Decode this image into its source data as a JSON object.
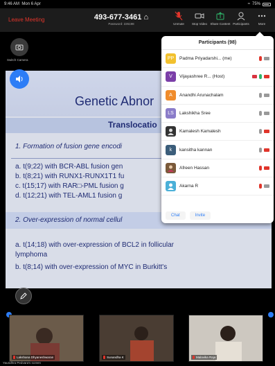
{
  "status_bar": {
    "time": "9:46 AM",
    "date": "Mon 6 Apr",
    "battery": "75%"
  },
  "toolbar": {
    "leave_label": "Leave Meeting",
    "meeting_id": "493-677-3461",
    "password_text": "Password: 226198",
    "tools": [
      {
        "icon": "unmute-icon",
        "label": "Unmute"
      },
      {
        "icon": "video-icon",
        "label": "Stop Video"
      },
      {
        "icon": "share-icon",
        "label": "Share Content"
      },
      {
        "icon": "participants-icon",
        "label": "Participants"
      },
      {
        "icon": "more-icon",
        "label": "More"
      }
    ]
  },
  "side": {
    "switch_camera_label": "Switch Camera"
  },
  "slide": {
    "title": "Genetic Abnor",
    "subtitle": "Translocatio",
    "lines": [
      "1.    Formation of fusion gene encodi",
      "a.    t(9;22) with BCR-ABL fusion gen",
      "b.    t(8;21) with RUNX1-RUNX1T1 fu",
      "c.    t(15;17) with RAR□-PML fusion g",
      "d.    t(12;21) with TEL-AML1 fusion g",
      "2.    Over-expression of normal cellul",
      "a.    t(14;18) with over-expression of BCL2 in follicular",
      "        lymphoma",
      "b.    t(8;14) with over-expression of MYC in Burkitt's"
    ]
  },
  "participants": {
    "title": "Participants (98)",
    "list": [
      {
        "initials": "PP",
        "color": "#f2c12e",
        "name": "Padma Priyadarshi... (me)",
        "muted": true,
        "video_off": false,
        "host": false
      },
      {
        "initials": "V",
        "color": "#7b3fa8",
        "name": "Vijayashree R... (Host)",
        "muted": false,
        "video_off": true,
        "host": true
      },
      {
        "initials": "A",
        "color": "#f08c2c",
        "name": "Anandhi Arunachalam",
        "muted": false,
        "video_off": false,
        "host": false
      },
      {
        "initials": "LS",
        "color": "#8a7cc9",
        "name": "Lakshikha Sree",
        "muted": false,
        "video_off": false,
        "host": false
      },
      {
        "initials": "",
        "color": "#333333",
        "name": "Kamalesh Kamalesh",
        "muted": false,
        "video_off": true,
        "host": false
      },
      {
        "initials": "k",
        "color": "#3b5d7a",
        "name": "kansitha kannan",
        "muted": false,
        "video_off": true,
        "host": false
      },
      {
        "initials": "",
        "color": "#7a5a3a",
        "name": "Afreen Hassan",
        "muted": true,
        "video_off": true,
        "host": false
      },
      {
        "initials": "",
        "color": "#4bb0d8",
        "name": "Akarna R",
        "muted": true,
        "video_off": false,
        "host": false
      }
    ],
    "chat_label": "Chat",
    "invite_label": "Invite"
  },
  "tiles": [
    {
      "name": "Lakshana Dhyaneshwaran"
    },
    {
      "name": "Sunandha K"
    },
    {
      "name": "Malavika Raja"
    }
  ],
  "bottom_label": "Yaundhra Pedvara's screen"
}
